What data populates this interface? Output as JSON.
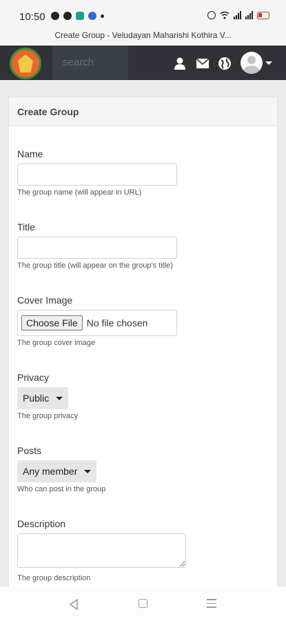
{
  "status_bar": {
    "time": "10:50",
    "left_icons": [
      "whatsapp-icon",
      "facebook-icon",
      "app-icon",
      "messenger-icon",
      "dot-icon"
    ],
    "right_icons": [
      "alarm-icon",
      "wifi-icon",
      "signal-icon",
      "signal-icon",
      "battery-icon"
    ],
    "battery_color": "#c0392b"
  },
  "browser": {
    "page_title": "Create Group - Veludayan Maharishi Kothira V..."
  },
  "navbar": {
    "search_placeholder": "search",
    "icons": [
      "user-icon",
      "mail-icon",
      "globe-icon",
      "avatar",
      "caret-down-icon"
    ],
    "bg_color": "#2f3337"
  },
  "form": {
    "header": "Create Group",
    "name": {
      "label": "Name",
      "value": "",
      "help": "The group name (will appear in URL)"
    },
    "title": {
      "label": "Title",
      "value": "",
      "help": "The group title (will appear on the group's title)"
    },
    "cover_image": {
      "label": "Cover Image",
      "button": "Choose File",
      "status": "No file chosen",
      "help": "The group cover image"
    },
    "privacy": {
      "label": "Privacy",
      "selected": "Public",
      "help": "The group privacy"
    },
    "posts": {
      "label": "Posts",
      "selected": "Any member",
      "help": "Who can post in the group"
    },
    "description": {
      "label": "Description",
      "value": "",
      "help": "The group description"
    }
  },
  "android_nav": {
    "icons": [
      "back-icon",
      "home-icon",
      "menu-icon"
    ]
  }
}
